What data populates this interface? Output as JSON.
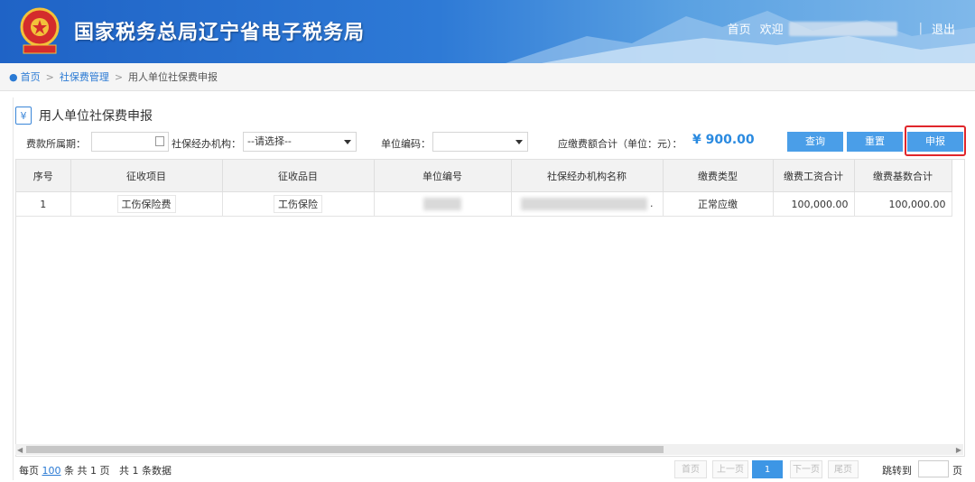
{
  "header": {
    "site_title": "国家税务总局辽宁省电子税务局",
    "home_link": "首页",
    "welcome": "欢迎",
    "logout": "退出"
  },
  "breadcrumb": {
    "home": "首页",
    "level1": "社保费管理",
    "current": "用人单位社保费申报"
  },
  "panel": {
    "title": "用人单位社保费申报"
  },
  "filters": {
    "period_label": "费款所属期：",
    "agency_label": "社保经办机构：",
    "agency_value": "--请选择--",
    "unit_code_label": "单位编码：",
    "total_label": "应缴费额合计（单位：元）：",
    "total_value": "¥ 900.00"
  },
  "buttons": {
    "query": "查询",
    "reset": "重置",
    "declare": "申报"
  },
  "table": {
    "headers": [
      "序号",
      "征收项目",
      "征收品目",
      "单位编号",
      "社保经办机构名称",
      "缴费类型",
      "缴费工资合计",
      "缴费基数合计"
    ],
    "rows": [
      {
        "index": "1",
        "item": "工伤保险费",
        "sub_item": "工伤保险",
        "agency_tail": ".",
        "pay_type": "正常应缴",
        "wage_total": "100,000.00",
        "base_total": "100,000.00"
      }
    ]
  },
  "pager": {
    "per_page_prefix": "每页",
    "per_page": "100",
    "per_page_suffix": "条 共 1 页",
    "total_records": "共 1 条数据",
    "first": "首页",
    "prev": "上一页",
    "current": "1",
    "next": "下一页",
    "last": "尾页",
    "jump_label": "跳转到",
    "jump_unit": "页"
  },
  "colors": {
    "accent": "#4a9ee8",
    "highlight": "#e0262b",
    "total": "#2a8ae0"
  }
}
